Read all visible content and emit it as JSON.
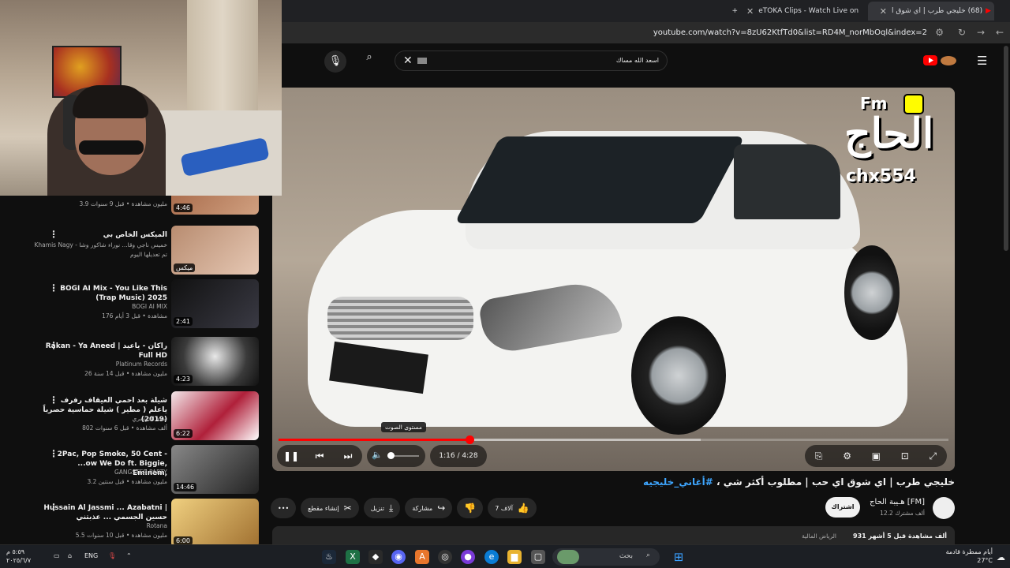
{
  "browser": {
    "tabs": [
      {
        "label": "(68) خليجي طرب | اي شوق ا"
      },
      {
        "label": "eTOKA Clips - Watch Live on K"
      }
    ],
    "new_tab": "+",
    "url": "youtube.com/watch?v=8zU62KtfTd0&list=RD4M_norMbOql&index=2"
  },
  "youtube": {
    "search_value": "اسعد الله مساك",
    "colors": {
      "accent": "#ff0000",
      "link": "#3ea6ff",
      "bg": "#0f0f0f",
      "chip": "#272727"
    }
  },
  "sidebar": {
    "items": [
      {
        "title": "",
        "channel": "",
        "meta": "3.9 مليون مشاهدة • قبل 9 سنوات",
        "duration": "4:46",
        "thumb": "#7a4a30"
      },
      {
        "title": "الميكس الخاص بي",
        "channel": "Khamis Nagy - خميس ناجي وقا... نوراء شاكور وشا",
        "meta": "تم تعديلها اليوم",
        "duration": "ميكس",
        "thumb": "#c9a089"
      },
      {
        "title": "BOGI AI Mix - You Like This (Trap Music) 2025",
        "channel": "BOGI AI MIX",
        "meta": "176 مشاهدة • قبل 3 أيام",
        "duration": "2:41",
        "thumb": "#1a1c22"
      },
      {
        "title": "Rakan - Ya Aneed | راكان - ياعيد Full HD",
        "channel": "Platinum Records",
        "meta": "26 مليون مشاهدة • قبل 14 سنة",
        "duration": "4:23",
        "thumb": "#2a2a2a"
      },
      {
        "title": "شيلة بعد احمي العيقاف رفرف ياعلم ( مطير ) شيلة حماسية حصرياً (2019)",
        "channel": "سعد الدوسري",
        "meta": "802 ألف مشاهدة • قبل 6 سنوات",
        "duration": "6:22",
        "thumb": "#b0203a"
      },
      {
        "title": "2Pac, Pop Smoke, 50 Cent - ...ow We Do ft. Biggie, Eminem,",
        "channel": "GANGSTER PARTY",
        "meta": "3.2 مليون مشاهدة • قبل سنتين",
        "duration": "14:46",
        "thumb": "#606060"
      },
      {
        "title": "Hussain Al Jassmi ... Azabatni | حسين الجسمي ... عذبتني",
        "channel": "Rotana",
        "meta": "5.5 مليون مشاهدة • قبل 10 سنوات",
        "duration": "6:00",
        "thumb": "#d8b060"
      }
    ]
  },
  "player": {
    "watermark_top": "Fm",
    "watermark_main": "الحاج",
    "watermark_handle": "chx554",
    "tooltip": "مستوى الصوت",
    "time": "1:16 / 4:28",
    "progress": 0.285,
    "buffered": 0.63,
    "volume": 0.05
  },
  "video": {
    "title": "خليجي طرب | اي شوق اي حب | مطلوب أكثر شي ،",
    "tags": "#أغاني_خليجيه",
    "channel_name": "هـيبة الحاج [FM]",
    "subscribers": "12.2 ألف مشترك",
    "subscribe_label": "اشتراك",
    "likes": "7 آلاف",
    "share_label": "مشاركة",
    "download_label": "تنزيل",
    "clip_label": "إنشاء مقطع",
    "views": "931 ألف مشاهدة قبل 5 أشهر",
    "tags_line": "الرياض المالية"
  },
  "taskbar": {
    "search_placeholder": "بحث",
    "lang": "ENG",
    "weather_line1": "أيام ممطرة قادمة",
    "weather_line2": "27°C",
    "clock_time": "٥:٥٩ م",
    "clock_date": "٢٠٢٥/٦/٧"
  }
}
